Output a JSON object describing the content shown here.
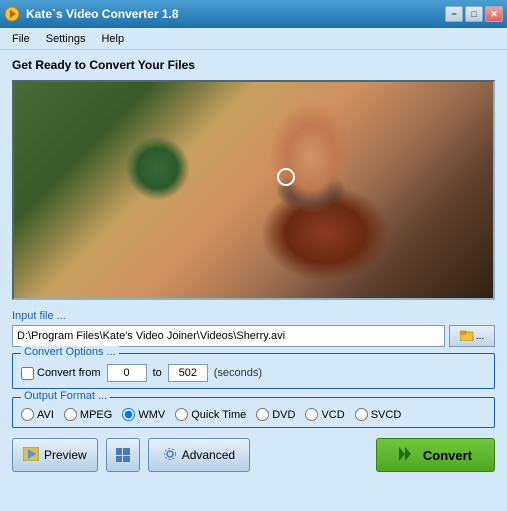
{
  "window": {
    "title": "Kate`s Video Converter 1.8",
    "minimize_label": "−",
    "restore_label": "□",
    "close_label": "✕"
  },
  "menu": {
    "items": [
      "File",
      "Settings",
      "Help"
    ]
  },
  "main": {
    "heading": "Get Ready to Convert Your Files",
    "input_section": {
      "label": "Input file ...",
      "file_path": "D:\\Program Files\\Kate's Video Joiner\\Videos\\Sherry.avi",
      "browse_label": "..."
    },
    "convert_options": {
      "label": "Convert Options ...",
      "checkbox_label": "Convert from",
      "from_value": "0",
      "to_value": "502",
      "seconds_label": "(seconds)"
    },
    "output_format": {
      "label": "Output Format ...",
      "formats": [
        "AVI",
        "MPEG",
        "WMV",
        "Quick Time",
        "DVD",
        "VCD",
        "SVCD"
      ],
      "selected": "WMV"
    },
    "buttons": {
      "preview_label": "Preview",
      "advanced_label": "Advanced",
      "convert_label": "Convert"
    }
  }
}
